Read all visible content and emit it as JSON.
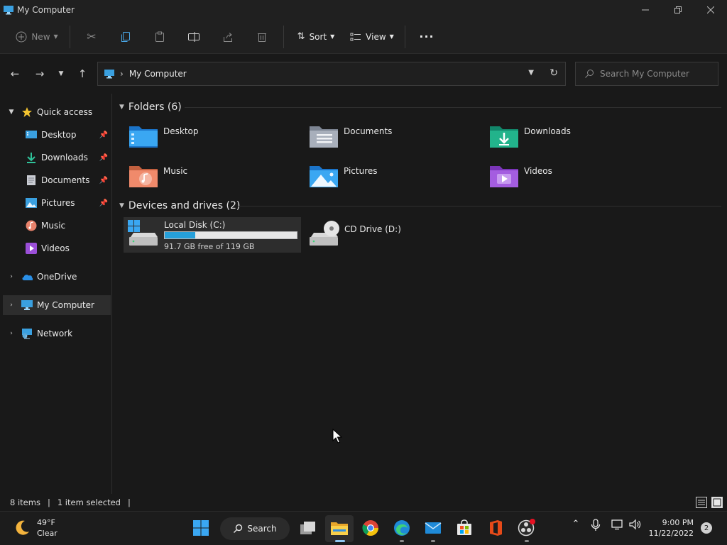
{
  "window": {
    "title": "My Computer"
  },
  "commandbar": {
    "new_label": "New",
    "sort_label": "Sort",
    "view_label": "View",
    "more_label": "···"
  },
  "address": {
    "crumb": "My Computer"
  },
  "search": {
    "placeholder": "Search My Computer"
  },
  "sidebar": {
    "quick_access": "Quick access",
    "items": [
      {
        "label": "Desktop",
        "icon": "desktop-icon",
        "pinned": true
      },
      {
        "label": "Downloads",
        "icon": "downloads-icon",
        "pinned": true
      },
      {
        "label": "Documents",
        "icon": "documents-icon",
        "pinned": true
      },
      {
        "label": "Pictures",
        "icon": "pictures-icon",
        "pinned": true
      },
      {
        "label": "Music",
        "icon": "music-icon",
        "pinned": false
      },
      {
        "label": "Videos",
        "icon": "videos-icon",
        "pinned": false
      }
    ],
    "onedrive": "OneDrive",
    "my_computer": "My Computer",
    "network": "Network"
  },
  "content": {
    "folders_header": "Folders (6)",
    "folders": [
      {
        "label": "Desktop",
        "icon": "desktop-folder-icon"
      },
      {
        "label": "Documents",
        "icon": "documents-folder-icon"
      },
      {
        "label": "Downloads",
        "icon": "downloads-folder-icon"
      },
      {
        "label": "Music",
        "icon": "music-folder-icon"
      },
      {
        "label": "Pictures",
        "icon": "pictures-folder-icon"
      },
      {
        "label": "Videos",
        "icon": "videos-folder-icon"
      }
    ],
    "drives_header": "Devices and drives (2)",
    "drives": [
      {
        "label": "Local Disk (C:)",
        "free_text": "91.7 GB free of 119 GB",
        "used_fraction": 0.23,
        "icon": "local-disk-icon"
      },
      {
        "label": "CD Drive (D:)",
        "icon": "cd-drive-icon"
      }
    ]
  },
  "status": {
    "items": "8 items",
    "selected": "1 item selected"
  },
  "taskbar": {
    "weather_temp": "49°F",
    "weather_desc": "Clear",
    "search_label": "Search",
    "time": "9:00 PM",
    "date": "11/22/2022",
    "notifications": "2"
  },
  "colors": {
    "accent": "#26a0da",
    "background": "#191919",
    "selected": "#2d2d2d"
  }
}
